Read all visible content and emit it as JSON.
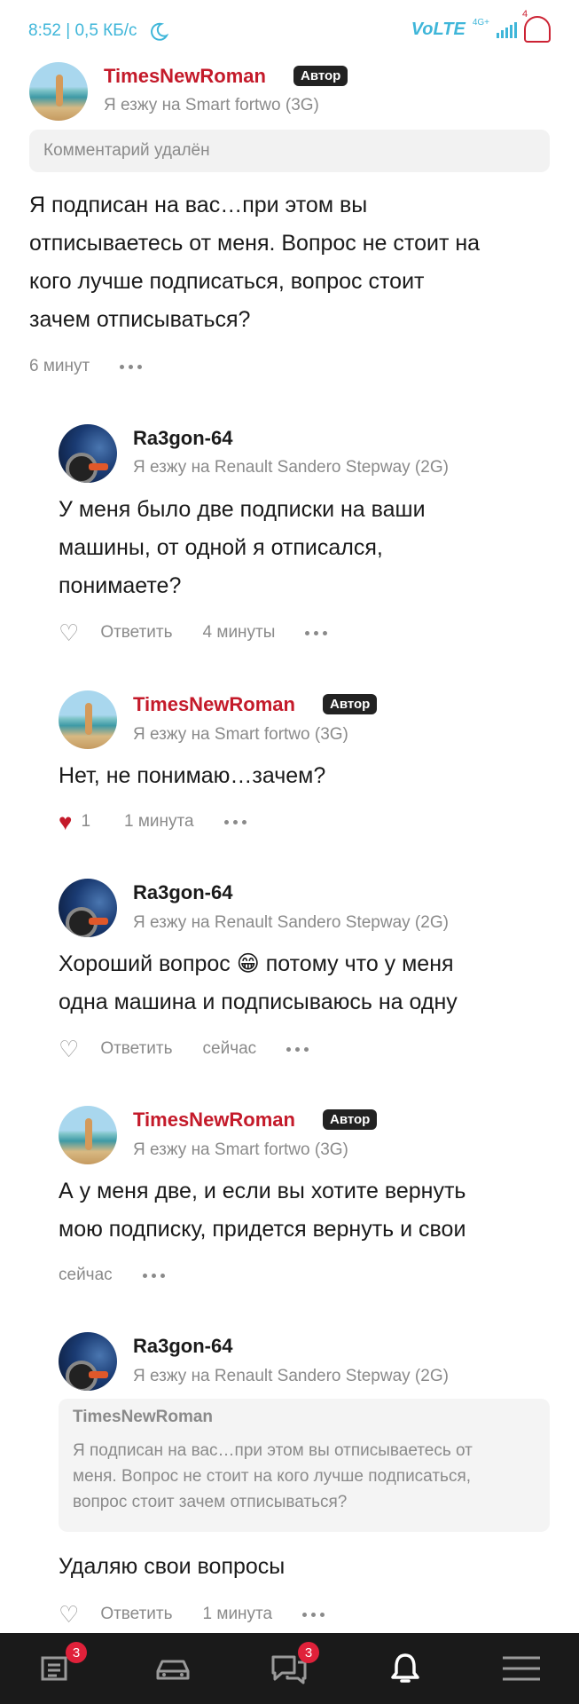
{
  "status_bar": {
    "time_speed": "8:52 | 0,5 КБ/с",
    "volte": "VoLTE",
    "network": "4G+",
    "battery_level": "4"
  },
  "comments": [
    {
      "author": "TimesNewRoman",
      "author_color": "#c41a2a",
      "badge": "Автор",
      "car": "Я езжу на Smart fortwo (3G)",
      "deleted_note": "Комментарий удалён",
      "lines": [
        "Я подписан на вас…при этом вы",
        "отписываетесь от меня. Вопрос не стоит на",
        "кого лучше подписаться, вопрос стоит",
        "зачем отписываться?"
      ],
      "time": "6 минут"
    },
    {
      "author": "Ra3gon-64",
      "car": "Я езжу на Renault Sandero Stepway (2G)",
      "lines": [
        "У меня было две подписки на ваши",
        "машины, от одной я отписался,",
        "понимаете?"
      ],
      "reply": "Ответить",
      "time": "4 минуты"
    },
    {
      "author": "TimesNewRoman",
      "author_color": "#c41a2a",
      "badge": "Автор",
      "car": "Я езжу на Smart fortwo (3G)",
      "lines": [
        "Нет, не понимаю…зачем?"
      ],
      "likes": "1",
      "time": "1 минута"
    },
    {
      "author": "Ra3gon-64",
      "car": "Я езжу на Renault Sandero Stepway (2G)",
      "lines": [
        "Хороший вопрос 😁 потому что у меня",
        "одна машина и подписываюсь на одну"
      ],
      "reply": "Ответить",
      "time": "сейчас"
    },
    {
      "author": "TimesNewRoman",
      "author_color": "#c41a2a",
      "badge": "Автор",
      "car": "Я езжу на Smart fortwo (3G)",
      "lines": [
        "А у меня две, и если вы хотите вернуть",
        "мою подписку, придется вернуть и свои"
      ],
      "time": "сейчас"
    },
    {
      "author": "Ra3gon-64",
      "car": "Я езжу на Renault Sandero Stepway (2G)",
      "quote": {
        "author": "TimesNewRoman",
        "lines": [
          "Я подписан на вас…при этом вы отписываетесь от",
          "меня. Вопрос не стоит на кого лучше подписаться,",
          "вопрос стоит зачем отписываться?"
        ]
      },
      "lines": [
        "Удаляю свои вопросы"
      ],
      "reply": "Ответить",
      "time": "1 минута"
    }
  ],
  "bottom_nav": {
    "feed_badge": "3",
    "messages_badge": "3",
    "icons": [
      "feed-icon",
      "car-icon",
      "chat-icon",
      "bell-icon",
      "menu-icon"
    ],
    "active": "bell-icon"
  }
}
